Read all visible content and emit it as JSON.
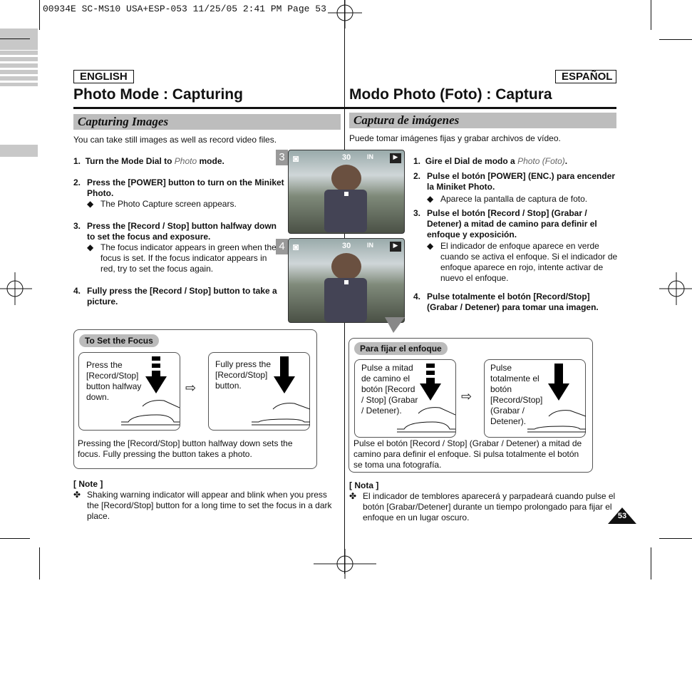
{
  "header": {
    "slug": "00934E SC-MS10 USA+ESP-053  11/25/05 2:41 PM  Page 53"
  },
  "en": {
    "lang": "ENGLISH",
    "title": "Photo Mode : Capturing",
    "section": "Capturing Images",
    "intro": "You can take still images as well as record video files.",
    "steps": [
      {
        "n": "1.",
        "pre": "Turn the Mode Dial to ",
        "em": "Photo",
        "post": " mode."
      },
      {
        "n": "2.",
        "text": "Press the [POWER] button to turn on the Miniket Photo.",
        "bullet": "The Photo Capture screen appears."
      },
      {
        "n": "3.",
        "text": "Press the [Record / Stop] button halfway down to set the focus and exposure.",
        "bullet": "The focus indicator appears in green when the focus is set. If the focus indicator appears in red, try to set the focus again."
      },
      {
        "n": "4.",
        "text": "Fully press the [Record / Stop] button to take a picture."
      }
    ],
    "focus": {
      "label": "To Set the Focus",
      "half": "Press the [Record/Stop] button halfway down.",
      "full": "Fully press the [Record/Stop] button.",
      "caption": "Pressing the [Record/Stop] button halfway down sets the focus. Fully pressing the button takes a photo."
    },
    "note": {
      "label": "[ Note ]",
      "text": "Shaking warning indicator will appear and blink when you press the [Record/Stop] button for a long time to set the focus in a dark place."
    }
  },
  "es": {
    "lang": "ESPAÑOL",
    "title": "Modo Photo (Foto) : Captura",
    "section": "Captura de imágenes",
    "intro": "Puede tomar imágenes fijas y grabar archivos de vídeo.",
    "steps": [
      {
        "n": "1.",
        "pre": "Gire el Dial de modo a ",
        "em": "Photo (Foto)",
        "post": "."
      },
      {
        "n": "2.",
        "text": "Pulse el botón [POWER] (ENC.) para encender la Miniket Photo.",
        "bullet": "Aparece la pantalla de captura de foto."
      },
      {
        "n": "3.",
        "text": "Pulse el botón [Record / Stop] (Grabar / Detener) a mitad de camino para definir el enfoque y exposición.",
        "bullet": "El indicador de enfoque aparece en verde cuando se activa el enfoque. Si el indicador de enfoque aparece en rojo, intente activar de nuevo el enfoque."
      },
      {
        "n": "4.",
        "text": "Pulse totalmente el botón [Record/Stop] (Grabar / Detener) para tomar una imagen."
      }
    ],
    "focus": {
      "label": "Para fijar el enfoque",
      "half": "Pulse a mitad de camino el botón [Record / Stop] (Grabar / Detener).",
      "full": "Pulse totalmente el botón [Record/Stop] (Grabar / Detener).",
      "caption": "Pulse el botón [Record / Stop] (Grabar / Detener) a mitad de camino para definir el enfoque. Si pulsa totalmente el botón se toma una fotografía."
    },
    "note": {
      "label": "[ Nota ]",
      "text": "El indicador de temblores aparecerá y parpadeará cuando pulse el botón [Grabar/Detener] durante un tiempo prolongado para fijar el enfoque en un lugar oscuro."
    }
  },
  "screens": [
    {
      "n": "3",
      "count": "30",
      "mem": "IN"
    },
    {
      "n": "4",
      "count": "30",
      "mem": "IN"
    }
  ],
  "page_number": "53",
  "icons": {
    "arrow": "hollow-right-arrow",
    "bullet": "diamond",
    "note": "cross-flower"
  }
}
